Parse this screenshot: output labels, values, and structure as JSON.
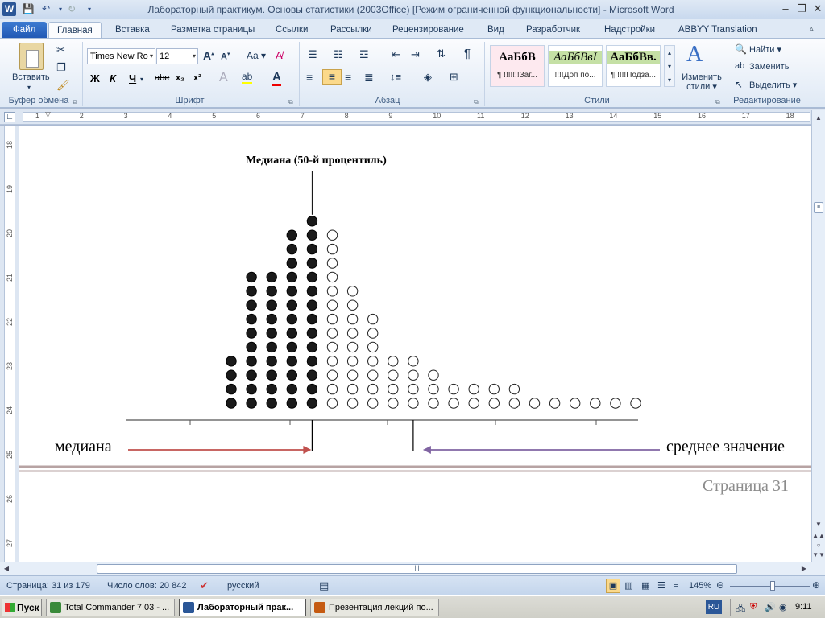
{
  "window": {
    "title": "Лабораторный практикум. Основы статистики (2003Office) [Режим ограниченной функциональности]  -  Microsoft Word",
    "app_icon": "word-icon"
  },
  "tabs": [
    "Файл",
    "Главная",
    "Вставка",
    "Разметка страницы",
    "Ссылки",
    "Рассылки",
    "Рецензирование",
    "Вид",
    "Разработчик",
    "Надстройки",
    "ABBYY Translation"
  ],
  "ribbon": {
    "clipboard": {
      "paste": "Вставить",
      "label": "Буфер обмена"
    },
    "font": {
      "name": "Times New Ro",
      "size": "12",
      "label": "Шрифт",
      "bold": "Ж",
      "italic": "К",
      "underline": "Ч",
      "strike": "abe",
      "sub": "x₂",
      "sup": "x²",
      "grow": "A",
      "shrink": "A",
      "case": "Aa"
    },
    "paragraph": {
      "label": "Абзац",
      "pilcrow": "¶"
    },
    "styles": {
      "label": "Стили",
      "items": [
        {
          "sample": "АаБбВ",
          "name": "¶ !!!!!!!Заг..."
        },
        {
          "sample": "АаБбВвI",
          "name": "!!!!Доп по..."
        },
        {
          "sample": "АаБбВв.",
          "name": "¶ !!!!Подза..."
        }
      ],
      "change": "Изменить",
      "change2": "стили"
    },
    "editing": {
      "label": "Редактирование",
      "find": "Найти",
      "replace": "Заменить",
      "select": "Выделить"
    }
  },
  "ruler": {
    "h": [
      "1",
      "2",
      "3",
      "4",
      "5",
      "6",
      "7",
      "8",
      "9",
      "10",
      "11",
      "12",
      "13",
      "14",
      "15",
      "16",
      "17",
      "18"
    ],
    "v": [
      "18",
      "19",
      "20",
      "21",
      "22",
      "23",
      "24",
      "25",
      "26",
      "27"
    ]
  },
  "figure": {
    "median_title": "Медиана (50-й процентиль)",
    "left_label": "медиана",
    "right_label": "среднее значение",
    "filled_columns": [
      4,
      10,
      10,
      13,
      14
    ],
    "hollow_columns": [
      13,
      9,
      7,
      4,
      4,
      3,
      2,
      2,
      2,
      2,
      1,
      1,
      1,
      1,
      1,
      1
    ],
    "colors": {
      "filled": "#1a1a1a",
      "left_arrow": "#c0504d",
      "right_arrow": "#8064a2",
      "page_border": "#b7a3a3"
    }
  },
  "page_footer": "Страница 31",
  "status": {
    "page": "Страница: 31 из 179",
    "words": "Число слов: 20 842",
    "lang": "русский",
    "zoom": "145%"
  },
  "taskbar": {
    "start": "Пуск",
    "tasks": [
      "Total Commander 7.03 - ...",
      "Лабораторный прак...",
      "Презентация лекций по..."
    ],
    "lang": "RU",
    "time": "9:11"
  }
}
